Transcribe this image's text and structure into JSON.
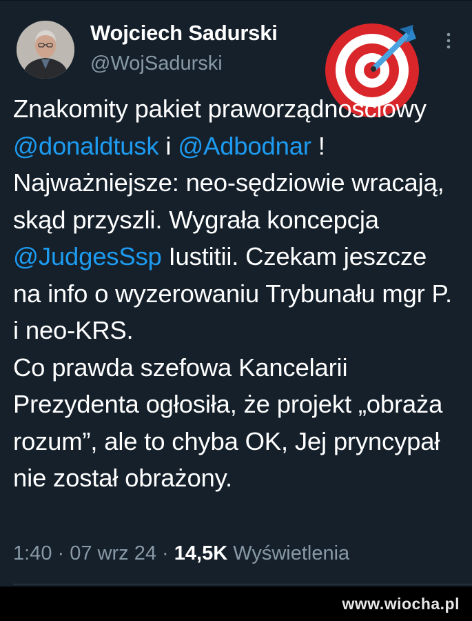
{
  "author": {
    "name": "Wojciech Sadurski",
    "handle": "@WojSadurski"
  },
  "tweet": {
    "t1": "Znakomity pakiet praworządnościowy ",
    "m1": "@donaldtusk",
    "t2": " i ",
    "m2": "@Adbodnar",
    "t3": " ! Najważniejsze: neo-sędziowie wracają, skąd przyszli. Wygrała koncepcja ",
    "m3": "@JudgesSsp",
    "t4": " Iustitii. Czekam jeszcze na info o wyzerowaniu Trybunału mgr P. i neo-KRS.",
    "t5": "Co prawda szefowa Kancelarii Prezydenta ogłosiła, że projekt „obraża rozum”, ale to chyba OK, Jej pryncypał nie został obrażony."
  },
  "meta": {
    "time": "1:40",
    "sep1": " · ",
    "date": "07 wrz 24",
    "sep2": " · ",
    "views_count": "14,5K",
    "views_label": " Wyświetlenia"
  },
  "watermark": "www.wiocha.pl",
  "icons": {
    "header": "target-icon",
    "menu": "more-vertical-icon"
  },
  "colors": {
    "background": "#15202b",
    "mention": "#1d9bf0",
    "muted": "#8899a6"
  }
}
